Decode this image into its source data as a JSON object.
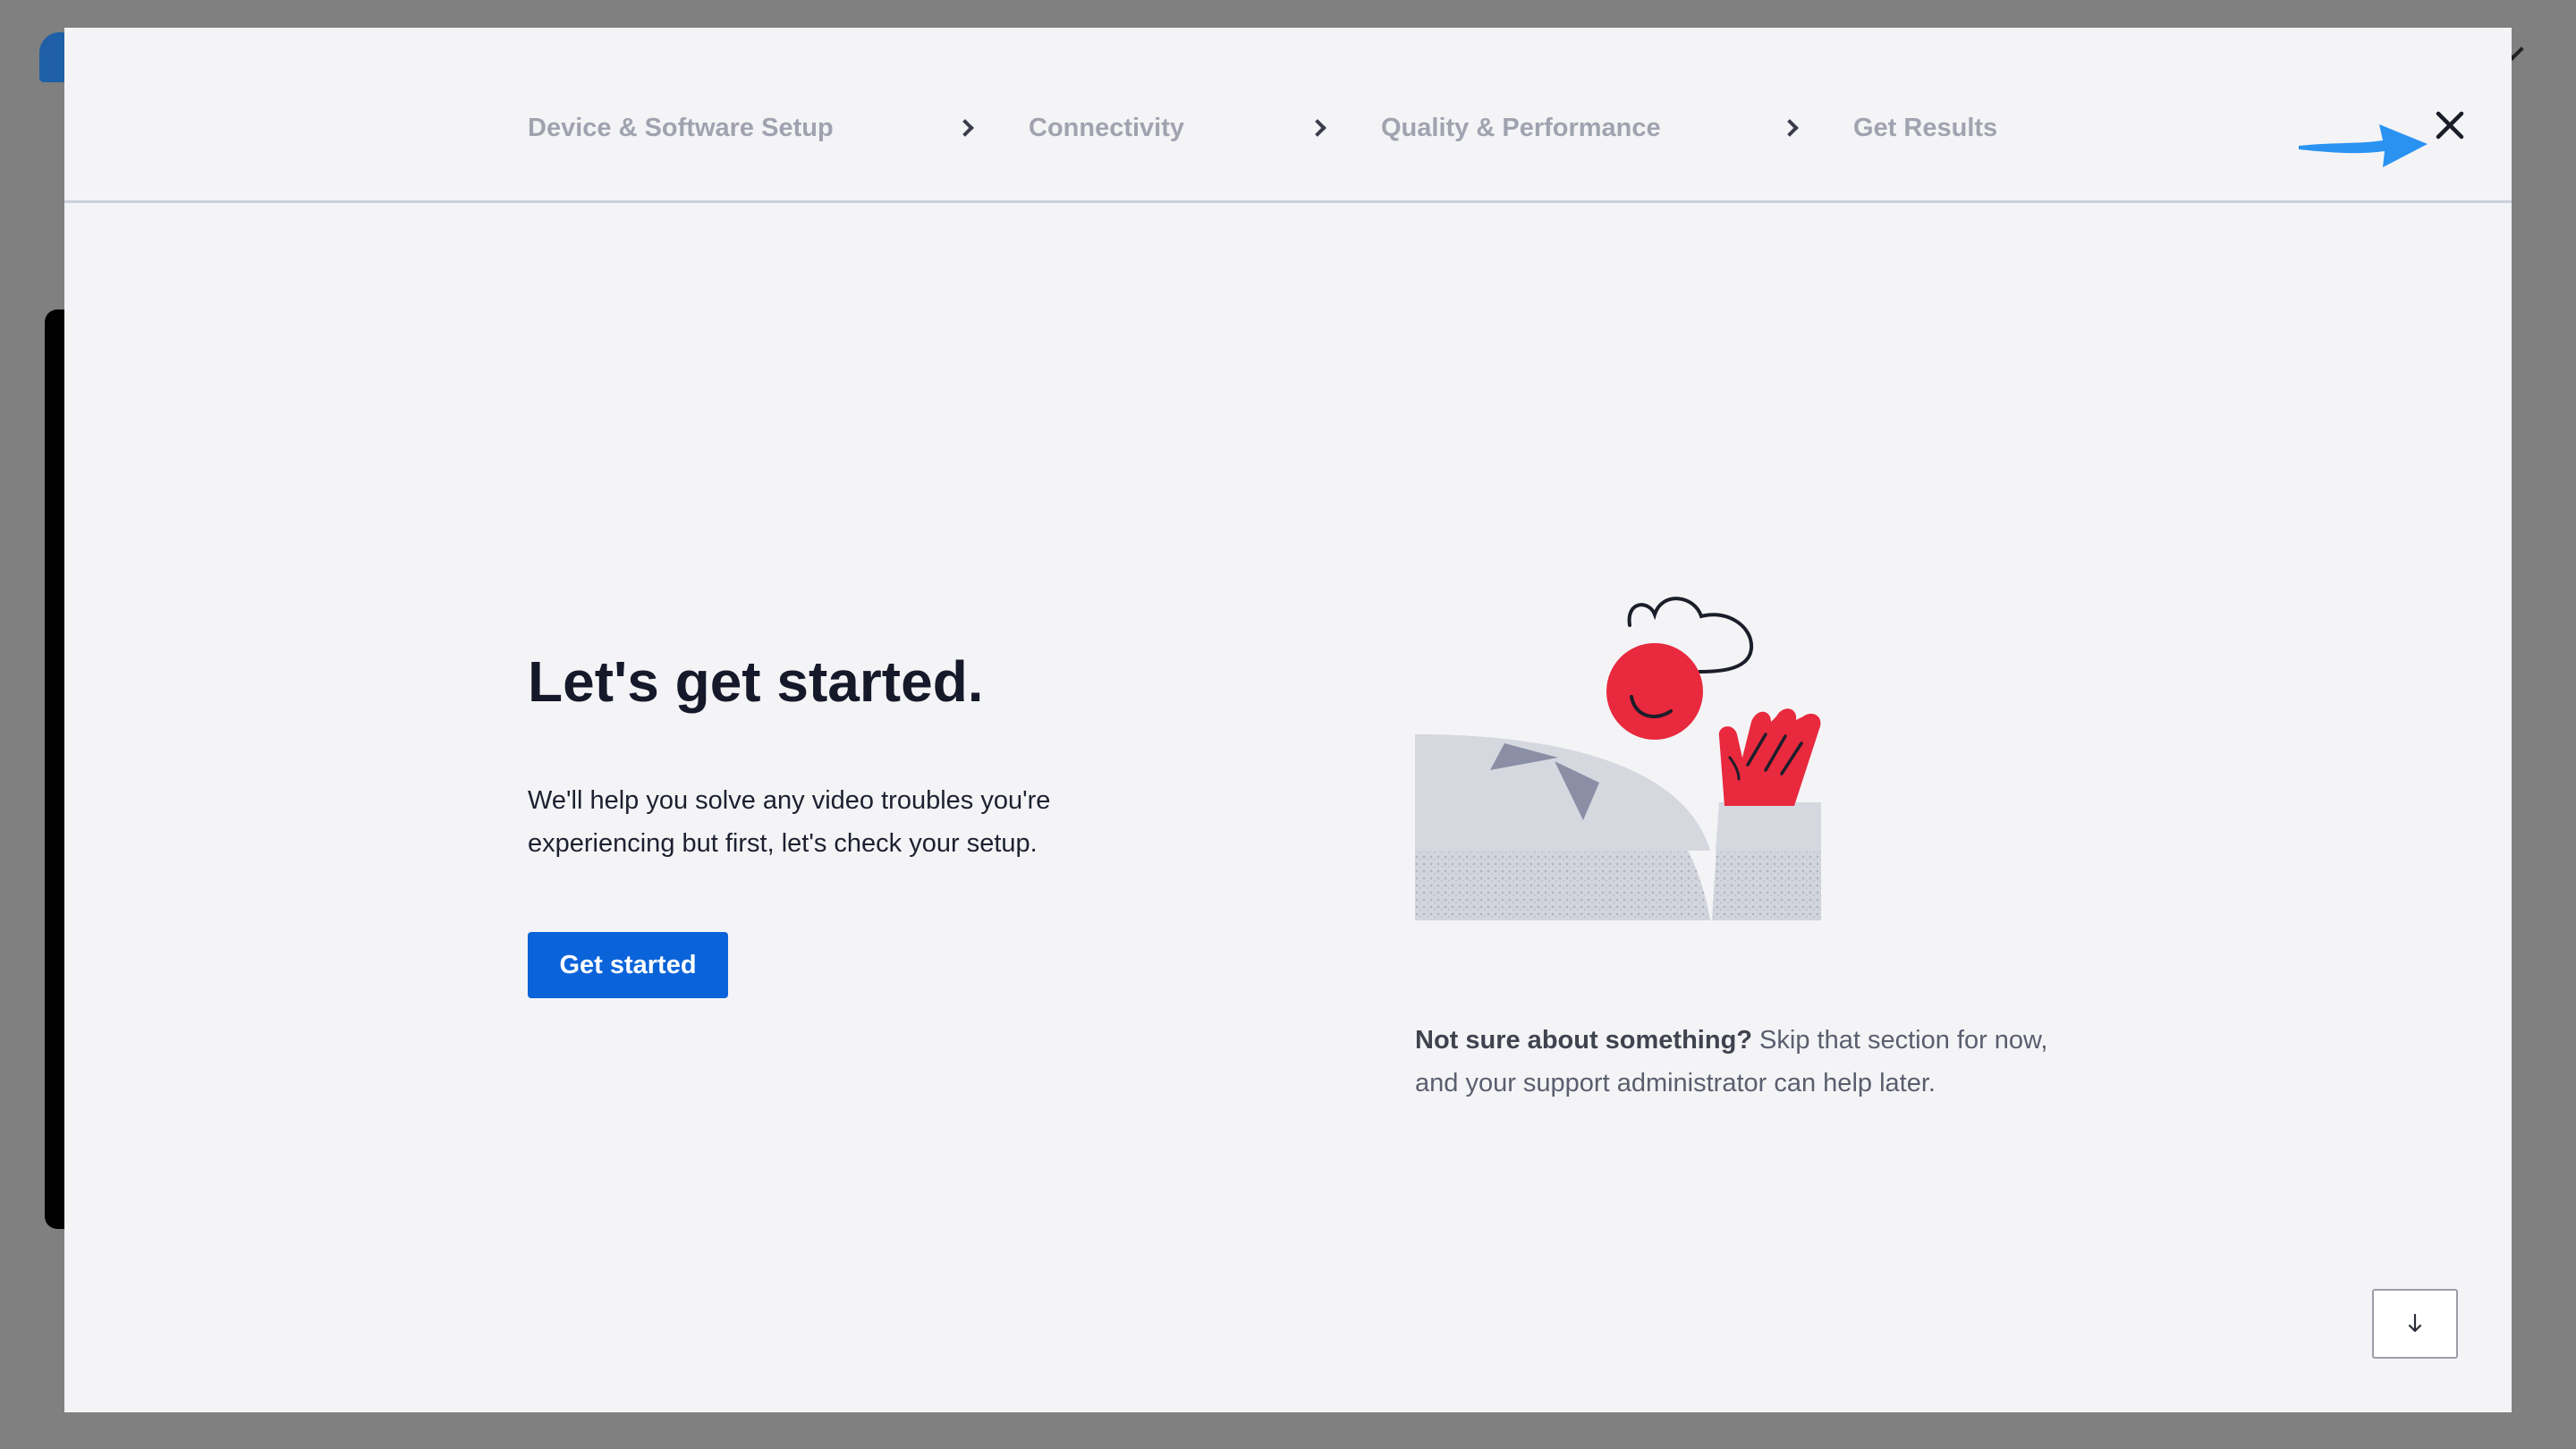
{
  "wizard": {
    "steps": [
      {
        "label": "Device & Software Setup"
      },
      {
        "label": "Connectivity"
      },
      {
        "label": "Quality & Performance"
      },
      {
        "label": "Get Results"
      }
    ],
    "close_icon": "close-icon",
    "step_separator_icon": "chevron-right-icon"
  },
  "intro": {
    "title": "Let's get started.",
    "description": "We'll help you solve any video troubles you're experiencing but first, let's check your setup.",
    "button_label": "Get started"
  },
  "note": {
    "bold": "Not sure about something?",
    "text": " Skip that section for now, and your support administrator can help later."
  },
  "scroll": {
    "icon": "arrow-down-icon"
  },
  "colors": {
    "accent": "#0b63d9",
    "illustration_red": "#e8293e",
    "annotation_arrow": "#2a93f2"
  }
}
